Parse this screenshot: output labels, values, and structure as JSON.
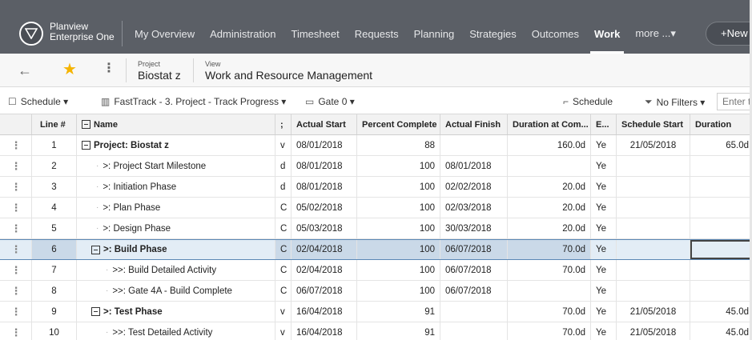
{
  "app": {
    "brand_line1": "Planview",
    "brand_line2": "Enterprise One",
    "nav": [
      {
        "label": "My Overview",
        "active": false
      },
      {
        "label": "Administration",
        "active": false
      },
      {
        "label": "Timesheet",
        "active": false
      },
      {
        "label": "Requests",
        "active": false
      },
      {
        "label": "Planning",
        "active": false
      },
      {
        "label": "Strategies",
        "active": false
      },
      {
        "label": "Outcomes",
        "active": false
      },
      {
        "label": "Work",
        "active": true
      },
      {
        "label": "more ...▾",
        "active": false
      }
    ],
    "new_button": "+New",
    "accent_color": "#5b5f66"
  },
  "subheader": {
    "project_label": "Project",
    "project_value": "Biostat z",
    "view_label": "View",
    "view_value": "Work and Resource Management"
  },
  "toolbar": {
    "schedule_menu": "Schedule ▾",
    "track_menu": "FastTrack - 3. Project - Track Progress ▾",
    "gate_menu": "Gate 0 ▾",
    "schedule_button": "Schedule",
    "filters": "No Filters ▾",
    "search_placeholder": "Enter te"
  },
  "grid": {
    "columns": [
      "Line #",
      "Name",
      ";",
      "Actual Start",
      "Percent Complete",
      "Actual Finish",
      "Duration at Com...",
      "E...",
      "Schedule Start",
      "Duration"
    ],
    "rows": [
      {
        "line": "1",
        "name": "Project: Biostat z",
        "prefix": "",
        "tree": true,
        "bold": true,
        "c": "v",
        "actual_start": "08/01/2018",
        "pct": "88",
        "actual_finish": "",
        "dur_comp": "160.0d",
        "e": "Ye",
        "sched_start": "21/05/2018",
        "duration": "65.0d"
      },
      {
        "line": "2",
        "name": ">: Project Start Milestone",
        "prefix": "·",
        "tree": false,
        "bold": false,
        "c": "d",
        "actual_start": "08/01/2018",
        "pct": "100",
        "actual_finish": "08/01/2018",
        "dur_comp": "",
        "e": "Ye",
        "sched_start": "",
        "duration": ""
      },
      {
        "line": "3",
        "name": ">: Initiation Phase",
        "prefix": "·",
        "tree": false,
        "bold": false,
        "c": "d",
        "actual_start": "08/01/2018",
        "pct": "100",
        "actual_finish": "02/02/2018",
        "dur_comp": "20.0d",
        "e": "Ye",
        "sched_start": "",
        "duration": ""
      },
      {
        "line": "4",
        "name": ">: Plan Phase",
        "prefix": "·",
        "tree": false,
        "bold": false,
        "c": "C",
        "actual_start": "05/02/2018",
        "pct": "100",
        "actual_finish": "02/03/2018",
        "dur_comp": "20.0d",
        "e": "Ye",
        "sched_start": "",
        "duration": ""
      },
      {
        "line": "5",
        "name": ">: Design Phase",
        "prefix": "·",
        "tree": false,
        "bold": false,
        "c": "C",
        "actual_start": "05/03/2018",
        "pct": "100",
        "actual_finish": "30/03/2018",
        "dur_comp": "20.0d",
        "e": "Ye",
        "sched_start": "",
        "duration": ""
      },
      {
        "line": "6",
        "name": ">: Build Phase",
        "prefix": "",
        "tree": true,
        "bold": true,
        "c": "C",
        "actual_start": "02/04/2018",
        "pct": "100",
        "actual_finish": "06/07/2018",
        "dur_comp": "70.0d",
        "e": "Ye",
        "sched_start": "",
        "duration": "",
        "selected": true
      },
      {
        "line": "7",
        "name": ">>: Build Detailed Activity",
        "prefix": "·",
        "tree": false,
        "bold": false,
        "c": "C",
        "actual_start": "02/04/2018",
        "pct": "100",
        "actual_finish": "06/07/2018",
        "dur_comp": "70.0d",
        "e": "Ye",
        "sched_start": "",
        "duration": ""
      },
      {
        "line": "8",
        "name": ">>: Gate 4A - Build Complete",
        "prefix": "·",
        "tree": false,
        "bold": false,
        "c": "C",
        "actual_start": "06/07/2018",
        "pct": "100",
        "actual_finish": "06/07/2018",
        "dur_comp": "",
        "e": "Ye",
        "sched_start": "",
        "duration": ""
      },
      {
        "line": "9",
        "name": ">: Test Phase",
        "prefix": "",
        "tree": true,
        "bold": true,
        "c": "v",
        "actual_start": "16/04/2018",
        "pct": "91",
        "actual_finish": "",
        "dur_comp": "70.0d",
        "e": "Ye",
        "sched_start": "21/05/2018",
        "duration": "45.0d"
      },
      {
        "line": "10",
        "name": ">>: Test Detailed Activity",
        "prefix": "·",
        "tree": false,
        "bold": false,
        "c": "v",
        "actual_start": "16/04/2018",
        "pct": "91",
        "actual_finish": "",
        "dur_comp": "70.0d",
        "e": "Ye",
        "sched_start": "21/05/2018",
        "duration": "45.0d"
      }
    ]
  }
}
